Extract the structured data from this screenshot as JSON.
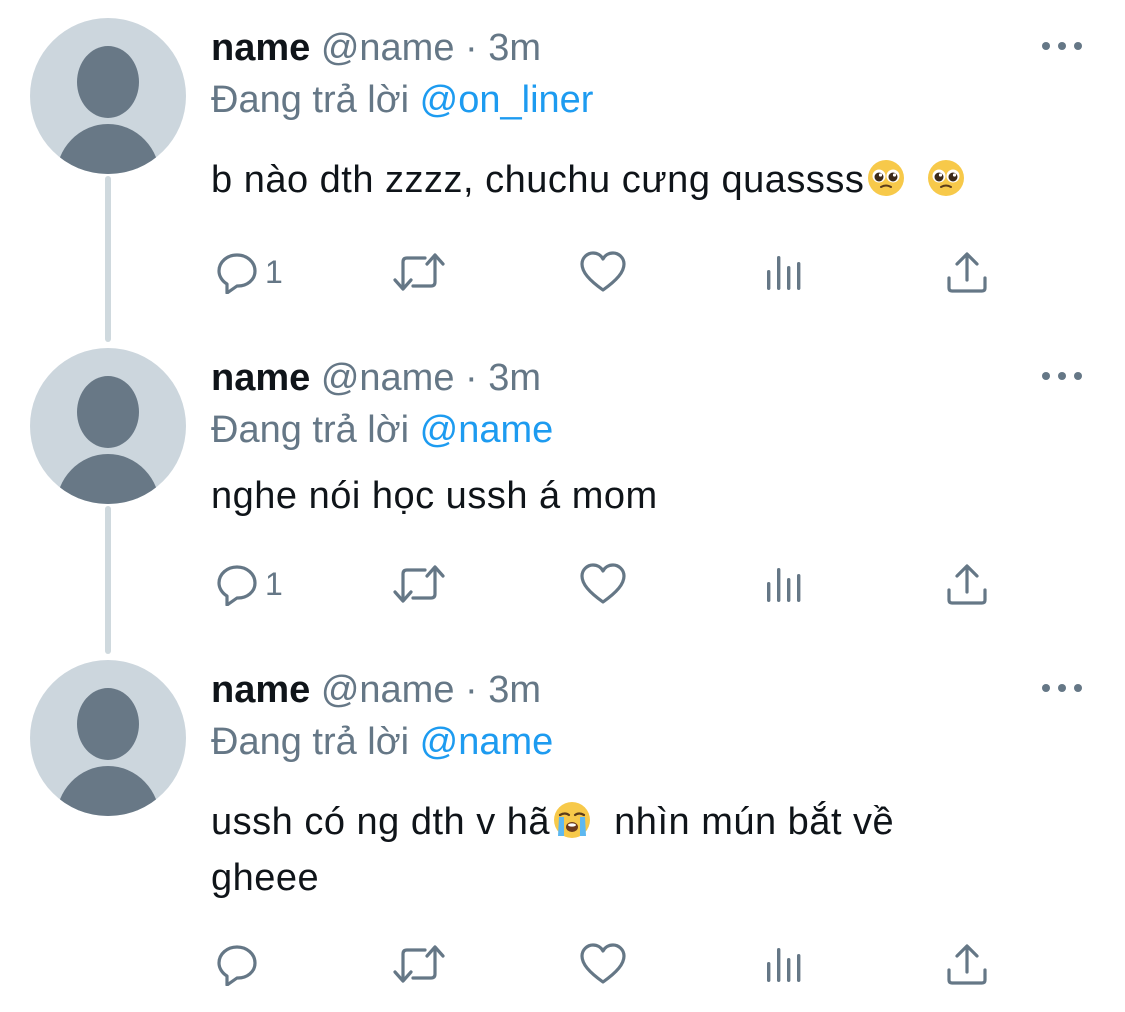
{
  "tweets": [
    {
      "display_name": "name",
      "handle": "@name",
      "separator": "·",
      "time": "3m",
      "reply_prefix": "Đang trả lời",
      "reply_to": "@on_liner",
      "text": "b nào dth zzzz, chuchu cưng quassss",
      "emojis": [
        "pleading-face",
        "pleading-face"
      ],
      "reply_count": "1"
    },
    {
      "display_name": "name",
      "handle": "@name",
      "separator": "·",
      "time": "3m",
      "reply_prefix": "Đang trả lời",
      "reply_to": "@name",
      "text": "nghe nói học ussh á mom",
      "reply_count": "1"
    },
    {
      "display_name": "name",
      "handle": "@name",
      "separator": "·",
      "time": "3m",
      "reply_prefix": "Đang trả lời",
      "reply_to": "@name",
      "text_before_emoji": "ussh có ng dth v hã",
      "emoji": "loudly-crying-face",
      "text_after_emoji": "  nhìn mún bắt về gheee",
      "reply_count": ""
    }
  ],
  "icons": {
    "reply": "reply-icon",
    "retweet": "retweet-icon",
    "like": "like-icon",
    "views": "views-icon",
    "share": "share-icon",
    "more": "more-icon"
  },
  "colors": {
    "link": "#1d9bf0",
    "muted": "#657786",
    "avatar_bg": "#ccd6dd",
    "avatar_fg": "#687886",
    "thread_line": "#cfd9de"
  }
}
